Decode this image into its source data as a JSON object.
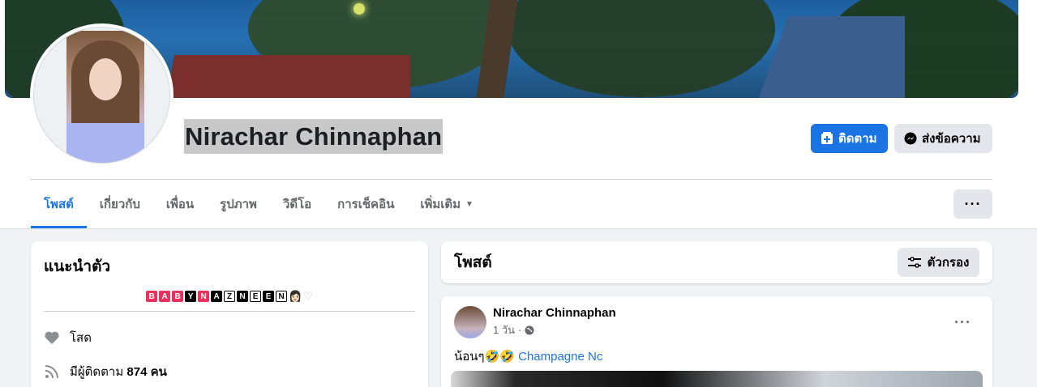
{
  "profile": {
    "name": "Nirachar Chinnaphan",
    "follow_label": "ติดตาม",
    "message_label": "ส่งข้อความ"
  },
  "tabs": [
    {
      "label": "โพสต์",
      "active": true
    },
    {
      "label": "เกี่ยวกับ"
    },
    {
      "label": "เพื่อน"
    },
    {
      "label": "รูปภาพ"
    },
    {
      "label": "วิดีโอ"
    },
    {
      "label": "การเช็คอิน"
    },
    {
      "label": "เพิ่มเติม"
    }
  ],
  "intro": {
    "title": "แนะนำตัว",
    "bio_letters": [
      "B",
      "A",
      "B",
      "Y",
      "N",
      "A",
      "Z",
      "N",
      "E",
      "E",
      "N"
    ],
    "relationship": "โสด",
    "followers_prefix": "มีผู้ติดตาม",
    "followers_count": "874 คน"
  },
  "posts_section": {
    "title": "โพสต์",
    "filter_label": "ตัวกรอง"
  },
  "post": {
    "author": "Nirachar Chinnaphan",
    "time": "1 วัน",
    "text": "น้อนๆ",
    "tagged": "Champagne Nc"
  },
  "colors": {
    "accent": "#1b74e4",
    "bio_pink": "#e8315b"
  }
}
